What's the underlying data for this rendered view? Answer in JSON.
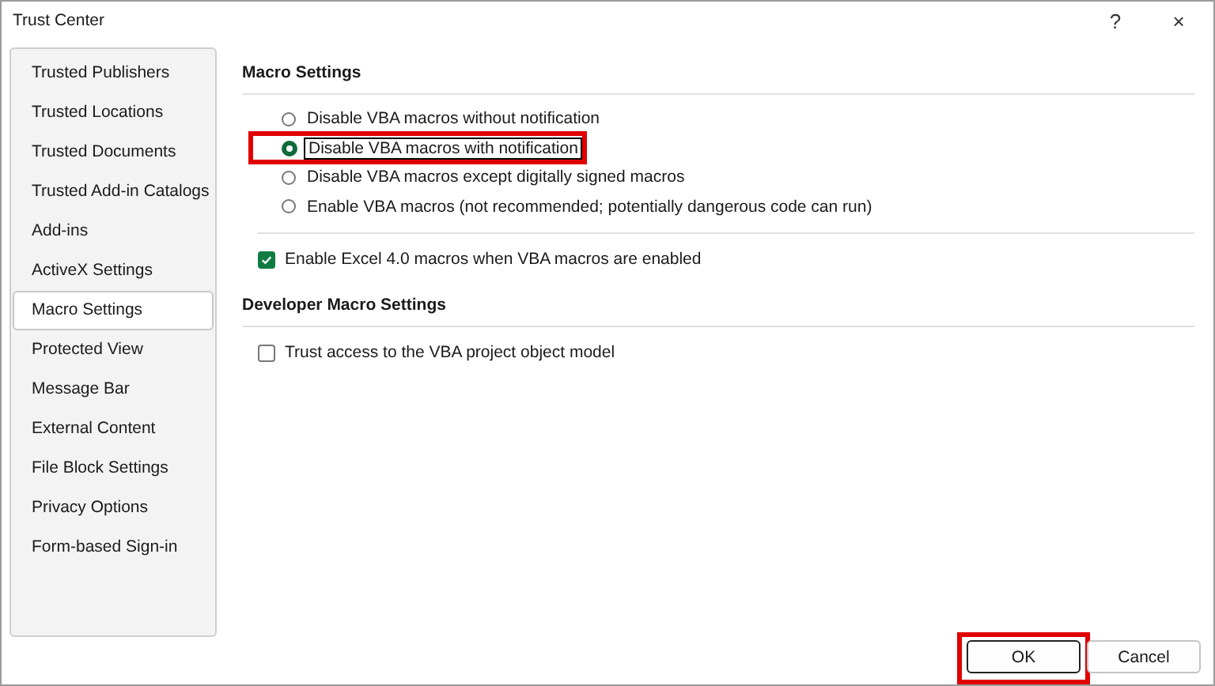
{
  "window": {
    "title": "Trust Center",
    "help": "?",
    "close": "×"
  },
  "sidebar": {
    "items": [
      {
        "label": "Trusted Publishers",
        "selected": false
      },
      {
        "label": "Trusted Locations",
        "selected": false
      },
      {
        "label": "Trusted Documents",
        "selected": false
      },
      {
        "label": "Trusted Add-in Catalogs",
        "selected": false
      },
      {
        "label": "Add-ins",
        "selected": false
      },
      {
        "label": "ActiveX Settings",
        "selected": false
      },
      {
        "label": "Macro Settings",
        "selected": true
      },
      {
        "label": "Protected View",
        "selected": false
      },
      {
        "label": "Message Bar",
        "selected": false
      },
      {
        "label": "External Content",
        "selected": false
      },
      {
        "label": "File Block Settings",
        "selected": false
      },
      {
        "label": "Privacy Options",
        "selected": false
      },
      {
        "label": "Form-based Sign-in",
        "selected": false
      }
    ]
  },
  "macro_settings": {
    "heading": "Macro Settings",
    "options": [
      {
        "label": "Disable VBA macros without notification",
        "selected": false,
        "highlighted": false
      },
      {
        "label": "Disable VBA macros with notification",
        "selected": true,
        "highlighted": true
      },
      {
        "label": "Disable VBA macros except digitally signed macros",
        "selected": false,
        "highlighted": false
      },
      {
        "label": "Enable VBA macros (not recommended; potentially dangerous code can run)",
        "selected": false,
        "highlighted": false
      }
    ],
    "checkbox": {
      "label": "Enable Excel 4.0 macros when VBA macros are enabled",
      "checked": true
    }
  },
  "developer_macro_settings": {
    "heading": "Developer Macro Settings",
    "checkbox": {
      "label": "Trust access to the VBA project object model",
      "checked": false
    }
  },
  "buttons": [
    {
      "label": "OK",
      "highlighted": true
    },
    {
      "label": "Cancel",
      "highlighted": false
    }
  ]
}
